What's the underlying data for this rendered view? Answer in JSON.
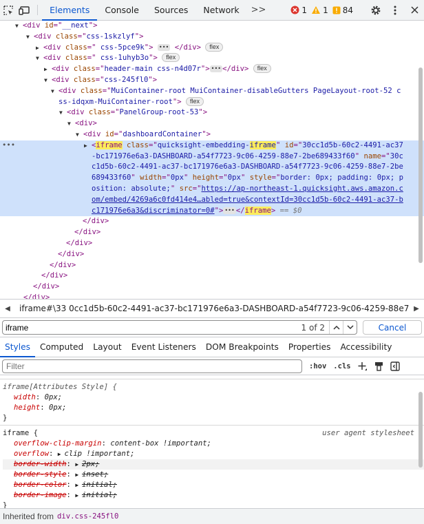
{
  "toolbar": {
    "tabs": [
      "Elements",
      "Console",
      "Sources",
      "Network"
    ],
    "more_tabs": ">>",
    "errors": "1",
    "warnings": "1",
    "info": "84"
  },
  "dom_tree": {
    "l1": {
      "tag_open": "<div ",
      "attr": "id",
      "eq": "=\"",
      "val": "__next",
      "close": "\">"
    },
    "l2": {
      "tag_open": "<div ",
      "attr": "class",
      "val": "css-1skzlyf",
      "close": ">"
    },
    "l3": {
      "tag_open": "<div ",
      "attr": "class",
      "val": " css-5pce9k",
      "close": ">",
      "end": "</div>",
      "badge": "flex"
    },
    "l4": {
      "tag_open": "<div ",
      "attr": "class",
      "val": " css-1uhyb3o",
      "close": ">",
      "badge": "flex"
    },
    "l5": {
      "tag_open": "<div ",
      "attr": "class",
      "val": "header-main css-n4d07r",
      "close": ">",
      "end": "</div>",
      "badge": "flex"
    },
    "l6": {
      "tag_open": "<div ",
      "attr": "class",
      "val": "css-245fl0",
      "close": ">"
    },
    "l7a": {
      "tag_open": "<div ",
      "attr": "class",
      "val": "MuiContainer-root MuiContainer-disableGutters PageLayout-root-52 c"
    },
    "l7b": {
      "val": "ss-idqxm-MuiContainer-root",
      "close": ">",
      "badge": "flex"
    },
    "l8": {
      "tag_open": "<div ",
      "attr": "class",
      "val": "PanelGroup-root-53",
      "close": ">"
    },
    "l9": {
      "tag": "<div>"
    },
    "l10": {
      "tag_open": "<div ",
      "attr": "id",
      "val": "dashboardContainer",
      "close": ">"
    },
    "iframe": {
      "lt": "<",
      "tag": "iframe",
      "attr_class": " class",
      "class_val_a": "quicksight-embedding-",
      "class_val_b": "iframe",
      "attr_id": " id",
      "id_val_1": "30cc1d5b-60c2-4491-ac37",
      "id_val_2": "-bc171976e6a3-DASHBOARD-a54f7723-9c06-4259-88e7-2be689433f60",
      "attr_name": " name",
      "name_val_2": "30c",
      "name_val_3": "c1d5b-60c2-4491-ac37-bc171976e6a3-DASHBOARD-a54f7723-9c06-4259-88e7-2be",
      "name_val_4": "689433f60",
      "attr_width": " width",
      "width_val": "0px",
      "attr_height": " height",
      "height_val": "0px",
      "attr_style": " style",
      "style_val_4": "border: 0px; padding: 0px; p",
      "style_val_5": "osition: absolute;",
      "attr_src": " src",
      "src_5": "https://ap-northeast-1.quicksight.aws.amazon.c",
      "src_6": "om/embed/4269a6c0fd414e4…abled=true&contextId=30cc1d5b-60c2-4491-ac37-b",
      "src_7": "c171976e6a3&discriminator=0#",
      "end_tag": "</iframe>",
      "eq_dollar": " == $0"
    },
    "closers": [
      "</div>",
      "</div>",
      "</div>",
      "</div>",
      "</div>",
      "</div>",
      "</div>",
      "</div>"
    ]
  },
  "breadcrumb": {
    "text": "iframe#\\33 0cc1d5b-60c2-4491-ac37-bc171976e6a3-DASHBOARD-a54f7723-9c06-4259-88e7-2be6894"
  },
  "search": {
    "value": "iframe",
    "count": "1 of 2",
    "cancel": "Cancel"
  },
  "subtabs": [
    "Styles",
    "Computed",
    "Layout",
    "Event Listeners",
    "DOM Breakpoints",
    "Properties",
    "Accessibility"
  ],
  "filter": {
    "placeholder": "Filter",
    "hov": ":hov",
    "cls": ".cls"
  },
  "styles": {
    "rule1": {
      "selector": "iframe[Attributes Style] {",
      "props": [
        {
          "name": "width",
          "value": "0px;"
        },
        {
          "name": "height",
          "value": "0px;"
        }
      ],
      "close": "}"
    },
    "rule2": {
      "selector": "iframe {",
      "source": "user agent stylesheet",
      "props": [
        {
          "name": "overflow-clip-margin",
          "value": "content-box !important;"
        },
        {
          "name": "overflow",
          "value": "clip !important;"
        },
        {
          "name": "border-width",
          "value": "2px;"
        },
        {
          "name": "border-style",
          "value": "inset;"
        },
        {
          "name": "border-color",
          "value": "initial;"
        },
        {
          "name": "border-image",
          "value": "initial;"
        }
      ],
      "close": "}"
    }
  },
  "inherited": {
    "label": "Inherited from",
    "class": "div.css-245fl0"
  }
}
